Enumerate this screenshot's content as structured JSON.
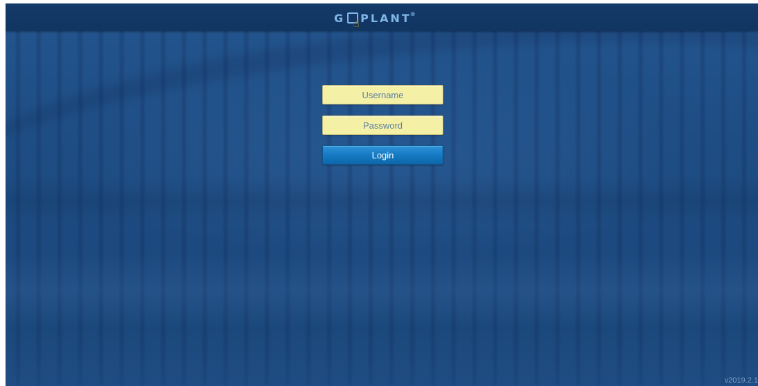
{
  "app": {
    "brand": {
      "prefix": "G",
      "suffix": "PLANT",
      "mark": "®",
      "icon": "pointing-hand-icon"
    }
  },
  "login": {
    "username_placeholder": "Username",
    "password_placeholder": "Password",
    "login_label": "Login"
  },
  "footer": {
    "version": "v2019.2.1"
  },
  "colors": {
    "background": "#1f4f86",
    "topbar": "#143a68",
    "field": "#f4f0a6",
    "button": "#1378c1",
    "logo": "#7fb6e8",
    "hand": "#f3b21e"
  }
}
